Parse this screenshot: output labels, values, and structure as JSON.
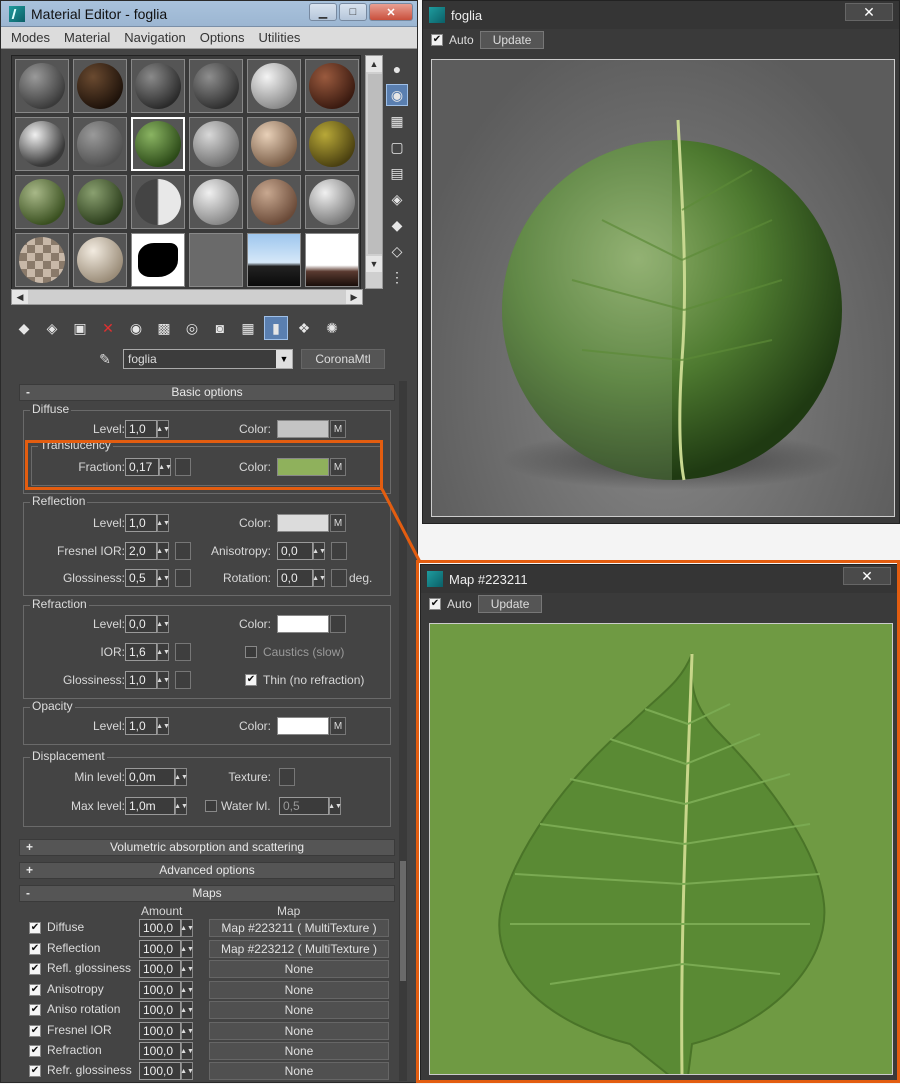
{
  "material_editor": {
    "title": "Material Editor - foglia",
    "menus": [
      "Modes",
      "Material",
      "Navigation",
      "Options",
      "Utilities"
    ],
    "material_name": "foglia",
    "material_type": "CoronaMtl"
  },
  "basic": {
    "header": "Basic options",
    "diffuse": {
      "group": "Diffuse",
      "level_label": "Level:",
      "level": "1,0",
      "color_label": "Color:",
      "color": "#c4c4c4",
      "map_btn": "M"
    },
    "translucency": {
      "group": "Translucency",
      "fraction_label": "Fraction:",
      "fraction": "0,17",
      "color_label": "Color:",
      "color": "#8fb15c",
      "map_btn": "M"
    },
    "reflection": {
      "group": "Reflection",
      "level_label": "Level:",
      "level": "1,0",
      "color_label": "Color:",
      "color": "#dcdcdc",
      "map_btn": "M",
      "fresnel_label": "Fresnel IOR:",
      "fresnel": "2,0",
      "aniso_label": "Anisotropy:",
      "aniso": "0,0",
      "gloss_label": "Glossiness:",
      "gloss": "0,5",
      "rotation_label": "Rotation:",
      "rotation": "0,0",
      "deg": "deg."
    },
    "refraction": {
      "group": "Refraction",
      "level_label": "Level:",
      "level": "0,0",
      "color_label": "Color:",
      "color": "#ffffff",
      "ior_label": "IOR:",
      "ior": "1,6",
      "caustics": "Caustics (slow)",
      "gloss_label": "Glossiness:",
      "gloss": "1,0",
      "thin": "Thin (no refraction)"
    },
    "opacity": {
      "group": "Opacity",
      "level_label": "Level:",
      "level": "1,0",
      "color_label": "Color:",
      "color": "#ffffff",
      "map_btn": "M"
    },
    "displacement": {
      "group": "Displacement",
      "min_label": "Min level:",
      "min": "0,0m",
      "texture_label": "Texture:",
      "max_label": "Max level:",
      "max": "1,0m",
      "water_label": "Water lvl.",
      "water": "0,5"
    }
  },
  "rollouts": {
    "volumetric": "Volumetric absorption and scattering",
    "advanced": "Advanced options",
    "maps": "Maps",
    "plus": "+",
    "minus": "-"
  },
  "maps": {
    "amount_header": "Amount",
    "map_header": "Map",
    "rows": [
      {
        "name": "Diffuse",
        "amount": "100,0",
        "map": "Map #223211  ( MultiTexture )"
      },
      {
        "name": "Reflection",
        "amount": "100,0",
        "map": "Map #223212  ( MultiTexture )"
      },
      {
        "name": "Refl. glossiness",
        "amount": "100,0",
        "map": "None"
      },
      {
        "name": "Anisotropy",
        "amount": "100,0",
        "map": "None"
      },
      {
        "name": "Aniso rotation",
        "amount": "100,0",
        "map": "None"
      },
      {
        "name": "Fresnel IOR",
        "amount": "100,0",
        "map": "None"
      },
      {
        "name": "Refraction",
        "amount": "100,0",
        "map": "None"
      },
      {
        "name": "Refr. glossiness",
        "amount": "100,0",
        "map": "None"
      }
    ]
  },
  "preview_window": {
    "title": "foglia",
    "auto": "Auto",
    "update": "Update",
    "close": "✕"
  },
  "map_window": {
    "title": "Map #223211",
    "auto": "Auto",
    "update": "Update",
    "close": "✕"
  },
  "colors": {
    "highlight": "#e35d10",
    "leaf": "#6f9a43"
  }
}
